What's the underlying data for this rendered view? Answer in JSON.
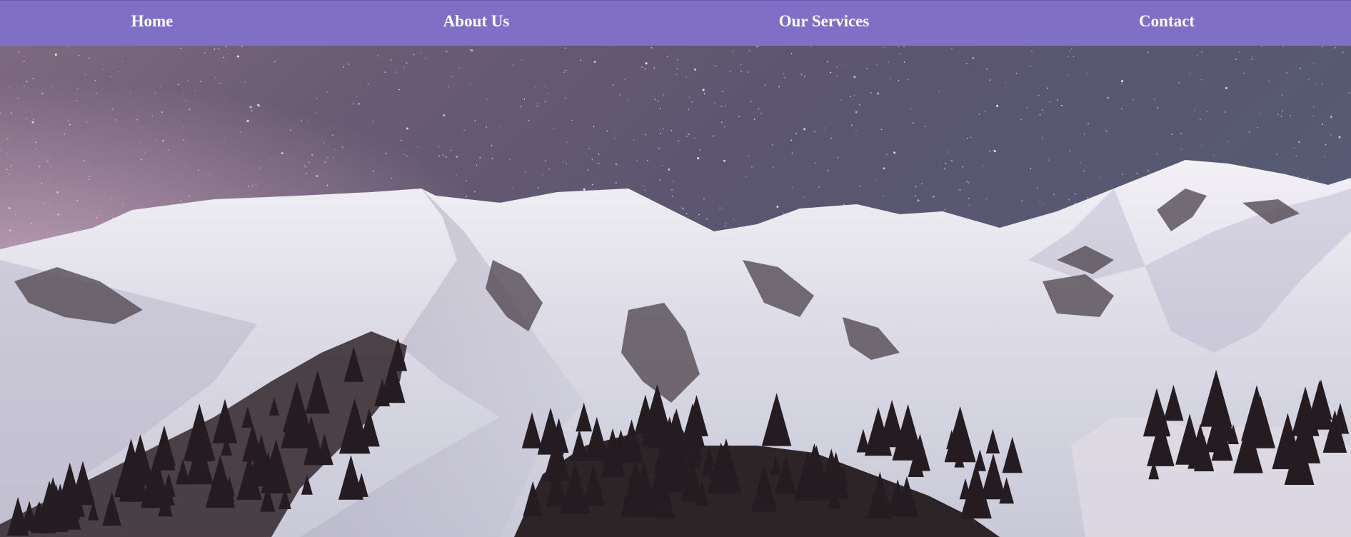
{
  "nav": {
    "items": [
      {
        "label": "Home"
      },
      {
        "label": "About Us"
      },
      {
        "label": "Our Services"
      },
      {
        "label": "Contact"
      }
    ],
    "background_color": "#7f6fc6",
    "text_color": "#ffffff"
  },
  "hero": {
    "image": "snowy-mountains-under-starry-night-sky"
  }
}
